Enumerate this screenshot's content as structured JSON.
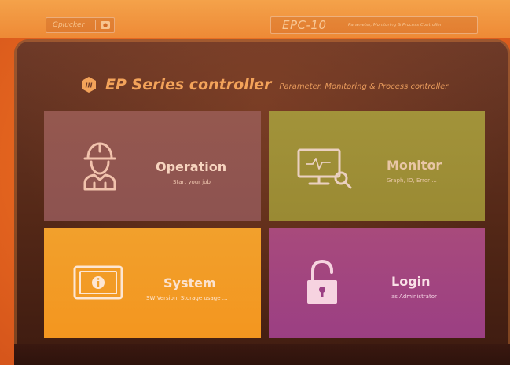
{
  "device": {
    "brand": "Gplucker",
    "model": "EPC-10",
    "model_description": "Parameter, Monitoring & Process Controller"
  },
  "screen": {
    "title": "EP Series controller",
    "subtitle": "Parameter, Monitoring & Process controller",
    "logo_icon": "hexagon-logo-icon"
  },
  "tiles": [
    {
      "title": "Operation",
      "subtitle": "Start your job",
      "icon": "worker-icon",
      "color": "#95584f"
    },
    {
      "title": "Monitor",
      "subtitle": "Graph, IO, Error ...",
      "icon": "monitor-search-icon",
      "color": "#a2933a"
    },
    {
      "title": "System",
      "subtitle": "SW Version, Storage usage ...",
      "icon": "info-tablet-icon",
      "color": "#f2a02c"
    },
    {
      "title": "Login",
      "subtitle": "as Administrator",
      "icon": "unlock-icon",
      "color": "#a84a7c"
    }
  ],
  "colors": {
    "accent": "#f08a2c",
    "title_text": "#f3a35a"
  }
}
